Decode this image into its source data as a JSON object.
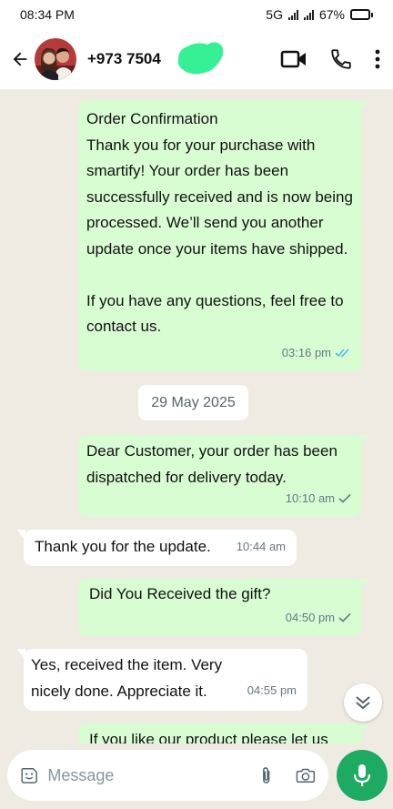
{
  "status_bar": {
    "time": "08:34 PM",
    "network": "5G",
    "battery_text": "67%",
    "battery_level": 0.67
  },
  "header": {
    "contact_name": "+973 7504"
  },
  "messages": [
    {
      "direction": "outgoing",
      "text": "Order Confirmation\nThank you for your purchase with smartify! Your order has been successfully received and is now being processed. We’ll send you another update once your items have shipped.\n\nIf you have any questions, feel free to contact us.",
      "time": "03:16 pm",
      "status": "read"
    },
    {
      "direction": "outgoing",
      "text": "Dear Customer, your order has been dispatched for delivery today.",
      "time": "10:10 am",
      "status": "sent"
    },
    {
      "direction": "incoming",
      "text": "Thank you for the update.",
      "time": "10:44 am"
    },
    {
      "direction": "outgoing",
      "text": "Did You Received the gift?",
      "time": "04:50 pm",
      "status": "sent"
    },
    {
      "direction": "incoming",
      "text": "Yes, received the item. Very nicely done. Appreciate it.",
      "time": "04:55 pm"
    },
    {
      "direction": "outgoing",
      "text": "If you like our product please let us",
      "time": ""
    }
  ],
  "date_separator": "29 May 2025",
  "composer": {
    "placeholder": "Message"
  },
  "colors": {
    "outgoing_bubble": "#d9fdd3",
    "incoming_bubble": "#ffffff",
    "background": "#efeae2",
    "accent_green": "#1daa61",
    "read_ticks": "#53bdeb",
    "redaction": "#35f095"
  }
}
